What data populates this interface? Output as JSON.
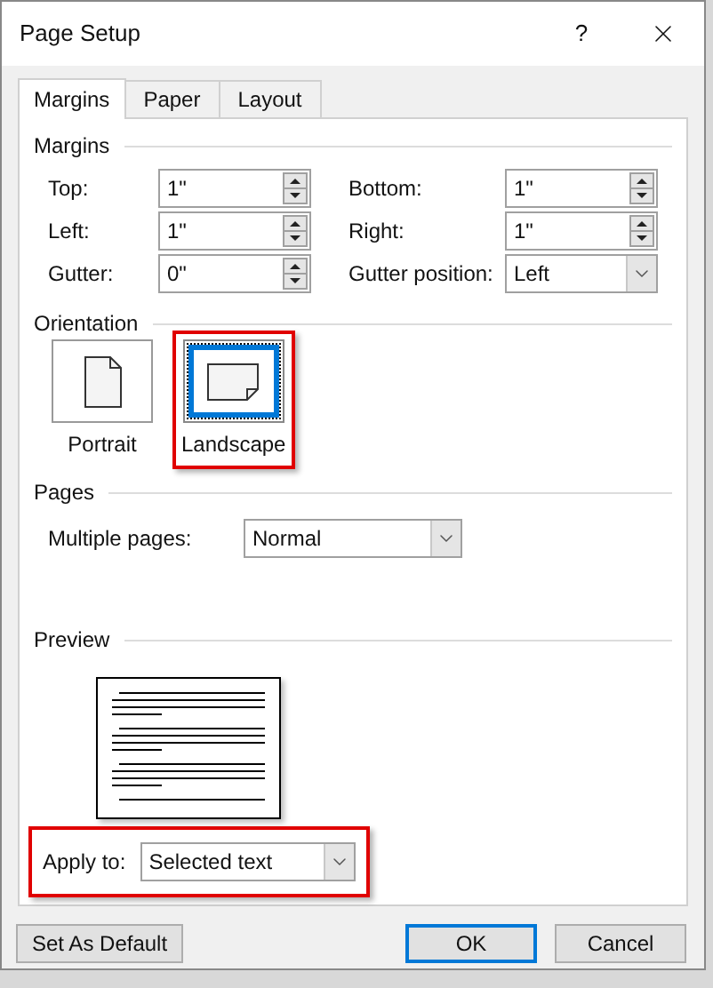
{
  "window": {
    "title": "Page Setup",
    "help": "?"
  },
  "tabs": [
    {
      "label": "Margins",
      "selected": true
    },
    {
      "label": "Paper",
      "selected": false
    },
    {
      "label": "Layout",
      "selected": false
    }
  ],
  "margins": {
    "title": "Margins",
    "fields": [
      {
        "label": "Top:",
        "value": "1\"",
        "kind": "spin"
      },
      {
        "label": "Bottom:",
        "value": "1\"",
        "kind": "spin"
      },
      {
        "label": "Left:",
        "value": "1\"",
        "kind": "spin"
      },
      {
        "label": "Right:",
        "value": "1\"",
        "kind": "spin"
      },
      {
        "label": "Gutter:",
        "value": "0\"",
        "kind": "spin"
      },
      {
        "label": "Gutter position:",
        "value": "Left",
        "kind": "dropdown"
      }
    ]
  },
  "orientation": {
    "title": "Orientation",
    "options": [
      {
        "label": "Portrait",
        "kind": "portrait",
        "selected": false,
        "highlighted": false
      },
      {
        "label": "Landscape",
        "kind": "landscape",
        "selected": true,
        "highlighted": true
      }
    ]
  },
  "pages": {
    "title": "Pages",
    "label": "Multiple pages:",
    "value": "Normal"
  },
  "preview": {
    "title": "Preview"
  },
  "apply_to": {
    "label": "Apply to:",
    "value": "Selected text",
    "highlighted": true
  },
  "buttons": [
    {
      "label": "Set As Default",
      "default": false
    },
    {
      "label": "OK",
      "default": true
    },
    {
      "label": "Cancel",
      "default": false
    }
  ]
}
